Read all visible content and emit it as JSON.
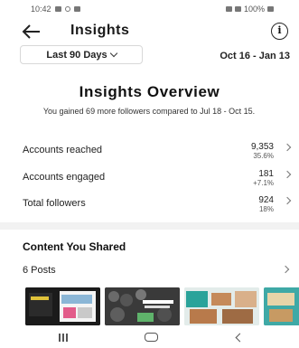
{
  "status_bar": {
    "time": "10:42",
    "battery": "100%"
  },
  "header": {
    "title": "Insights"
  },
  "date_filter": {
    "label": "Last 90 Days",
    "range": "Oct 16 - Jan 13"
  },
  "overview": {
    "title": "Insights Overview",
    "subtitle": "You gained 69 more followers compared to Jul 18 - Oct 15."
  },
  "metrics": [
    {
      "label": "Accounts reached",
      "value": "9,353",
      "change": "35.6%"
    },
    {
      "label": "Accounts engaged",
      "value": "181",
      "change": "+7.1%"
    },
    {
      "label": "Total followers",
      "value": "924",
      "change": "18%"
    }
  ],
  "content": {
    "title": "Content You Shared",
    "posts_label": "6 Posts"
  },
  "colors": {
    "background": "#ffffff",
    "divider": "#f2f2f2",
    "text": "#111111"
  },
  "icons": [
    "back-arrow-icon",
    "info-icon",
    "chevron-down-icon",
    "chevron-right-icon",
    "recent-apps-icon",
    "home-icon",
    "back-icon"
  ]
}
